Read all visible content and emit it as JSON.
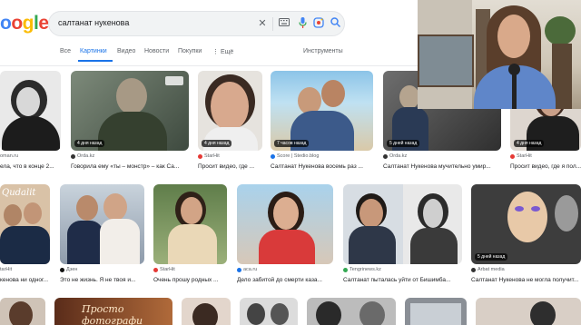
{
  "search": {
    "logo_visible": "ogle",
    "query": "салтанат нукенова"
  },
  "tabs": [
    {
      "label": "Все",
      "active": false
    },
    {
      "label": "Картинки",
      "active": true
    },
    {
      "label": "Видео",
      "active": false
    },
    {
      "label": "Новости",
      "active": false
    },
    {
      "label": "Покупки",
      "active": false
    },
    {
      "label": "⋮ Ещё",
      "active": false
    },
    {
      "label": "Инструменты",
      "active": false
    }
  ],
  "results_row1": [
    {
      "badge": "",
      "source": "oman.ru",
      "title": "ела, что в конце 2..."
    },
    {
      "badge": "4 дня назад",
      "source": "Orda.kz",
      "title": "Говорила ему «ты – монстр» – как Са..."
    },
    {
      "badge": "4 дня назад",
      "source": "StarHit",
      "title": "Просит видео, где ..."
    },
    {
      "badge": "7 часов назад",
      "source": "Score | Stedio.blog",
      "title": "Салтанат Нукенова восемь раз ..."
    },
    {
      "badge": "5 дней назад",
      "source": "Orda.kz",
      "title": "Салтанат Нукенова мучительно умир..."
    },
    {
      "badge": "4 дня назад",
      "source": "StarHit",
      "title": "Просит видео, где я пол..."
    }
  ],
  "results_row2": [
    {
      "badge": "",
      "source": "tarHit",
      "title": "кенова ни одног..."
    },
    {
      "badge": "",
      "source": "Дзен",
      "title": "Это не жизнь. Я не твоя и..."
    },
    {
      "badge": "",
      "source": "StarHit",
      "title": "Очень прошу родных ..."
    },
    {
      "badge": "",
      "source": "aca.ru",
      "title": "Дело забитой до смерти каза..."
    },
    {
      "badge": "",
      "source": "Tengrinews.kz",
      "title": "Салтанат пыталась уйти от Бишимба..."
    },
    {
      "badge": "5 дней назад",
      "source": "Arbat media",
      "title": "Салтанат Нукенова не могла получит..."
    }
  ],
  "row3_caption": "Просто фотографи",
  "thumb_overlay_text": "Qudalit"
}
